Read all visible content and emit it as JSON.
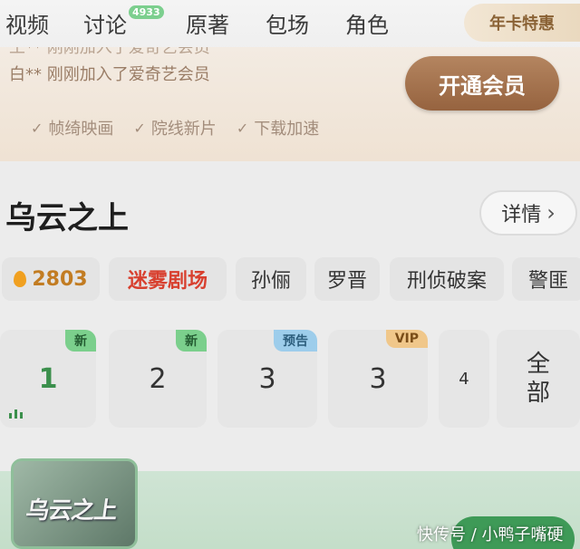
{
  "tabs": {
    "video": "视频",
    "discuss": "讨论",
    "discuss_count": "4933",
    "book": "原著",
    "booking": "包场",
    "roles": "角色",
    "annual_offer": "年卡特惠"
  },
  "vip": {
    "scroll_line_top": "王** 刚刚加入了爱奇艺会员",
    "scroll_line": "白** 刚刚加入了爱奇艺会员",
    "open_button": "开通会员",
    "benefits": [
      "帧绮映画",
      "院线新片",
      "下载加速"
    ]
  },
  "show": {
    "title": "乌云之上",
    "details": "详情",
    "heat": "2803",
    "theater": "迷雾剧场",
    "tags": [
      "孙俪",
      "罗晋",
      "刑侦破案",
      "警匪"
    ]
  },
  "episodes": [
    {
      "num": "1",
      "badge": "新"
    },
    {
      "num": "2",
      "badge": "新"
    },
    {
      "num": "3",
      "badge": "预告"
    },
    {
      "num": "3",
      "badge": "VIP"
    },
    {
      "num": "4",
      "badge": ""
    }
  ],
  "episodes_all": "全部",
  "promo": {
    "poster_title": "乌云之上"
  },
  "watermark": "快传号 / 小鸭子嘴硬",
  "colors": {
    "vip_button": "#96633f",
    "new_badge": "#7bcf8c",
    "preview_badge": "#9dcdeb",
    "vip_badge": "#f0c78a",
    "theater_red": "#d8402f"
  }
}
